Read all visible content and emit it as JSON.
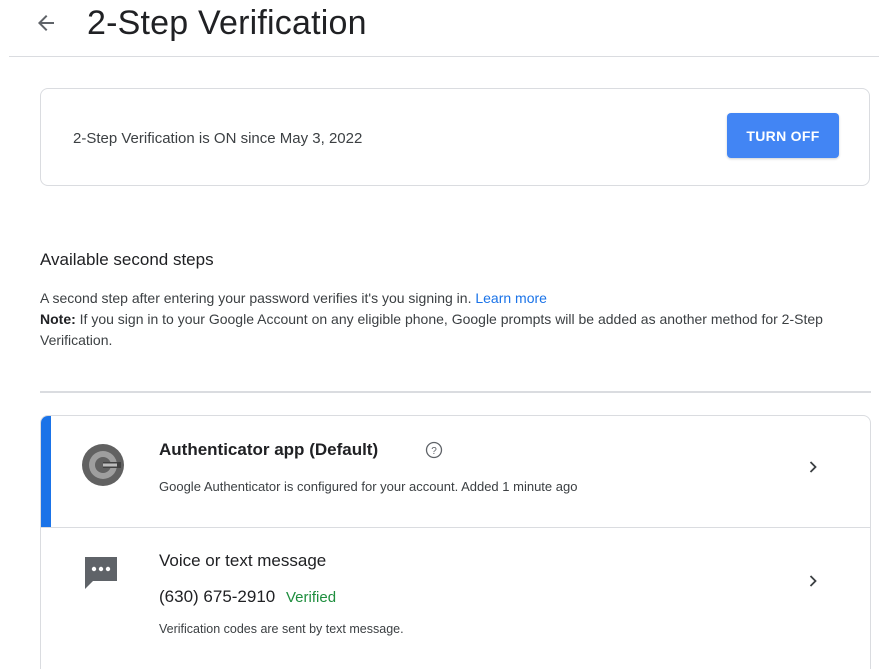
{
  "header": {
    "title": "2-Step Verification"
  },
  "status": {
    "text": "2-Step Verification is ON since May 3, 2022",
    "turn_off_label": "TURN OFF"
  },
  "available": {
    "heading": "Available second steps",
    "description": "A second step after entering your password verifies it's you signing in.",
    "learn_more": "Learn more",
    "note_label": "Note:",
    "note_text": " If you sign in to your Google Account on any eligible phone, Google prompts will be added as another method for 2-Step Verification."
  },
  "methods": [
    {
      "title": "Authenticator app",
      "title_suffix": "(Default)",
      "subtitle": "Google Authenticator is configured for your account. Added 1 minute ago",
      "icon": "google-authenticator-icon"
    },
    {
      "title": "Voice or text message",
      "phone": "(630) 675-2910",
      "verified_label": "Verified",
      "subtitle": "Verification codes are sent by text message.",
      "icon": "sms-icon"
    }
  ],
  "colors": {
    "accent": "#1a73e8",
    "button": "#4285f4",
    "verified": "#1e8e3e",
    "border": "#dadce0"
  }
}
